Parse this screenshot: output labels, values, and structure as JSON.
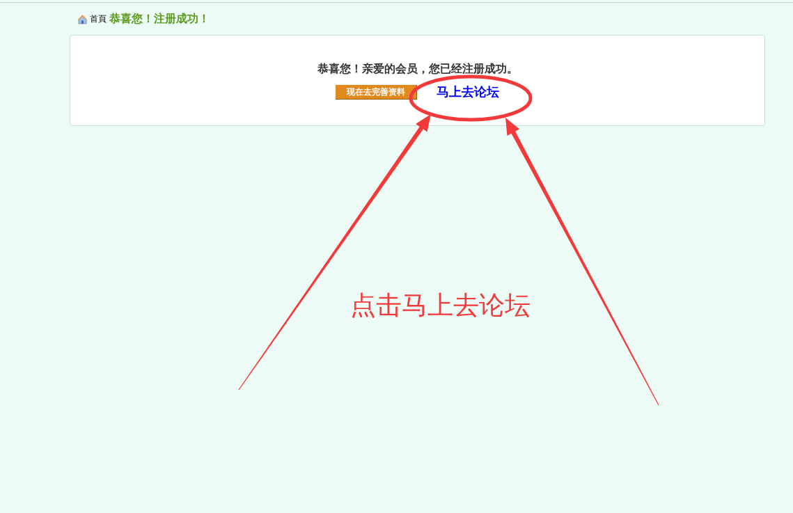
{
  "breadcrumb": {
    "home": "首頁",
    "title": "恭喜您！注册成功！"
  },
  "panel": {
    "message": "恭喜您！亲爱的会员，您已经注册成功。",
    "button": "现在去完善资料",
    "link": "马上去论坛"
  },
  "annotation": {
    "text": "点击马上去论坛"
  }
}
